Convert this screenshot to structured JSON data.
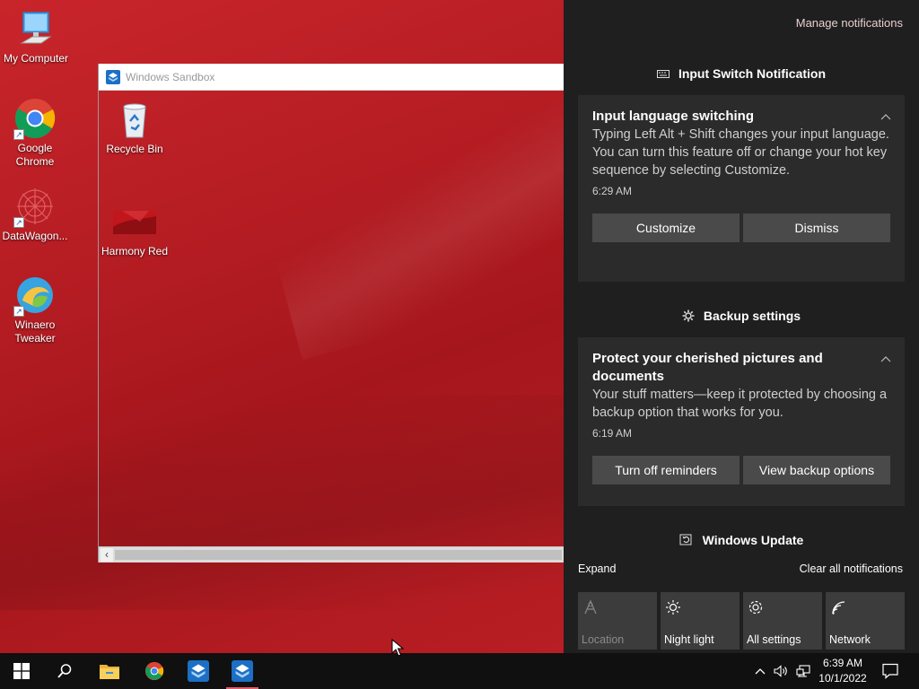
{
  "desktop": {
    "icons": [
      {
        "label": "My Computer",
        "icon": "computer-icon"
      },
      {
        "label": "Google Chrome",
        "icon": "chrome-icon"
      },
      {
        "label": "DataWagon...",
        "icon": "datawagon-icon"
      },
      {
        "label": "Winaero Tweaker",
        "icon": "winaero-icon"
      }
    ],
    "sandbox_icons": [
      {
        "label": "Recycle Bin",
        "icon": "recycle-bin-icon"
      },
      {
        "label": "Harmony Red",
        "icon": "wallpaper-icon"
      }
    ]
  },
  "sandbox_window": {
    "title": "Windows Sandbox"
  },
  "action_center": {
    "manage_link": "Manage notifications",
    "groups": [
      {
        "header": "Input Switch Notification",
        "icon": "keyboard-icon",
        "card": {
          "title": "Input language switching",
          "body": "Typing Left Alt + Shift changes your input language. You can turn this feature off or change your hot key sequence by selecting Customize.",
          "time": "6:29 AM",
          "buttons": [
            "Customize",
            "Dismiss"
          ]
        }
      },
      {
        "header": "Backup settings",
        "icon": "gear-icon",
        "card": {
          "title": "Protect your cherished pictures and documents",
          "body": "Your stuff matters—keep it protected by choosing a backup option that works for you.",
          "time": "6:19 AM",
          "buttons": [
            "Turn off reminders",
            "View backup options"
          ]
        }
      },
      {
        "header": "Windows Update",
        "icon": "update-icon"
      }
    ],
    "expand_label": "Expand",
    "clear_label": "Clear all notifications",
    "quick_actions": [
      {
        "label": "Location",
        "icon": "location-icon",
        "enabled": false
      },
      {
        "label": "Night light",
        "icon": "night-light-icon",
        "enabled": true
      },
      {
        "label": "All settings",
        "icon": "settings-icon",
        "enabled": true
      },
      {
        "label": "Network",
        "icon": "network-icon",
        "enabled": true
      }
    ]
  },
  "taskbar": {
    "time": "6:39 AM",
    "date": "10/1/2022",
    "colors": {
      "background": "#101010",
      "active_indicator": "#e05a6a"
    }
  }
}
